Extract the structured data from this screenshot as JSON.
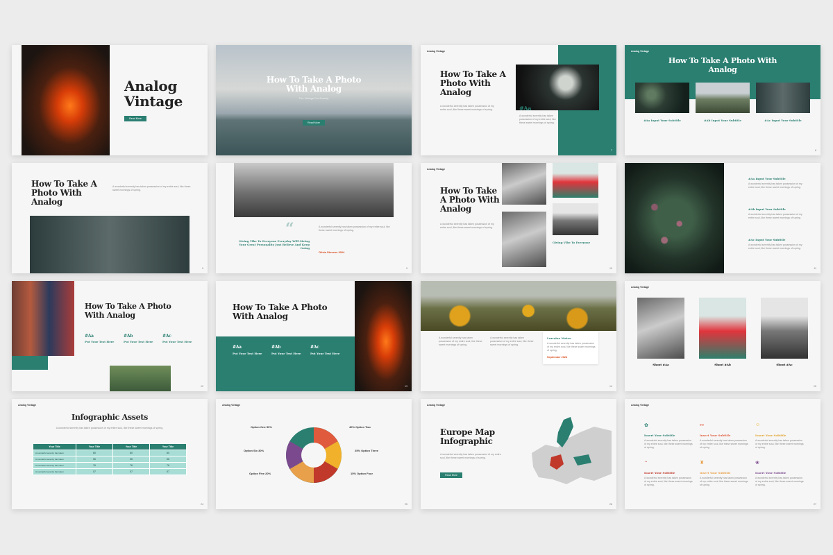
{
  "brand": "Analog Vintage",
  "accent": "#2a7f71",
  "highlight": "#d84a1b",
  "lorem_short": "A wonderful serenity has taken possession of my entire soul, like these sweet mornings of spring.",
  "s1": {
    "title": "Analog Vintage",
    "button": "Read More"
  },
  "s2": {
    "title": "How To Take A Photo With Analog",
    "subtitle": "The Vintage Era Exactly",
    "button": "Read More"
  },
  "s3": {
    "title": "How To Take A Photo With Analog",
    "tag": "#Aa",
    "page": "7"
  },
  "s4": {
    "title": "How To Take A Photo With Analog",
    "subs": [
      "#Aa Input Your Subtitle",
      "#Ab Input Your Subtitle",
      "#Ac Input Your Subtitle"
    ],
    "page": "8"
  },
  "s5": {
    "title": "How To Take A Photo With Analog",
    "page": "9"
  },
  "s6": {
    "quote": "Giving Vibe To Everyone Everyday Will Giving Your Great Personality Just Believe And Keep Going",
    "author": "Olivia Stevens 2024",
    "page": "9"
  },
  "s7": {
    "title": "How To Take A Photo With Analog",
    "caption": "Giving Vibe To Everyone",
    "page": "10"
  },
  "s8": {
    "subs": [
      "#Aa Input Your Subtitle",
      "#Ab Input Your Subtitle",
      "#Ac Input Your Subtitle"
    ],
    "page": "11"
  },
  "s9": {
    "title": "How To Take A Photo With Analog",
    "tags": [
      "#Aa",
      "#Ab",
      "#Ac"
    ],
    "label": "Put Your Text Here",
    "page": "12"
  },
  "s10": {
    "title": "How To Take A Photo With Analog",
    "tags": [
      "#Aa",
      "#Ab",
      "#Ac"
    ],
    "label": "Put Your Text Here",
    "page": "13"
  },
  "s11": {
    "name": "Lorraine Mateo",
    "date": "September 2024",
    "page": "14"
  },
  "s12": {
    "shoots": [
      "Shoot #Aa",
      "Shoot #Ab",
      "Shoot #Ac"
    ],
    "page": "15"
  },
  "s13": {
    "title": "Infographic Assets",
    "headers": [
      "Your Title",
      "Your Title",
      "Your Title",
      "Your Title"
    ],
    "row_label": "A wonderful serenity has taken",
    "rows": [
      [
        "80",
        "80",
        "80"
      ],
      [
        "56",
        "56",
        "56"
      ],
      [
        "76",
        "76",
        "76"
      ],
      [
        "57",
        "57",
        "57"
      ]
    ],
    "page": "24"
  },
  "s14": {
    "options": [
      {
        "label": "Option One",
        "value": "50%"
      },
      {
        "label": "Option Two",
        "value": "40%"
      },
      {
        "label": "Option Six",
        "value": "30%"
      },
      {
        "label": "Option Three",
        "value": "25%"
      },
      {
        "label": "Option Five",
        "value": "20%"
      },
      {
        "label": "Option Four",
        "value": "15%"
      }
    ],
    "page": "25"
  },
  "s15": {
    "title": "Europe Map Infographic",
    "button": "Read More",
    "page": "26"
  },
  "s16": {
    "subtitle": "Insert Your Subtitle",
    "page": "27"
  }
}
